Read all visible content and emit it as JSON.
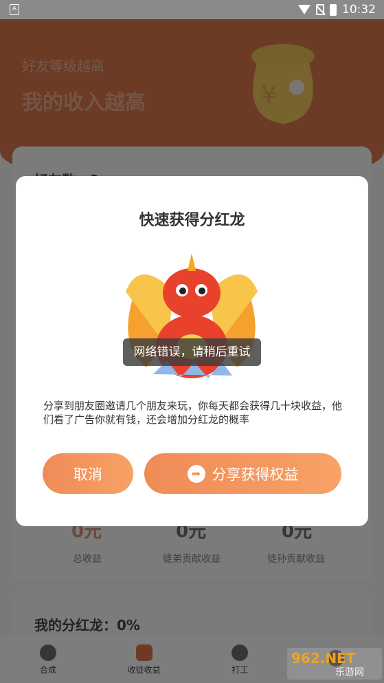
{
  "status_bar": {
    "left_badge": "A",
    "time": "10:32"
  },
  "header": {
    "subtitle": "好友等级越高",
    "title": "我的收入越高"
  },
  "background": {
    "friends_label": "好友数：0",
    "stats": [
      {
        "value": "0元",
        "label": "总收益"
      },
      {
        "value": "0元",
        "label": "徒弟贡献收益"
      },
      {
        "value": "0元",
        "label": "徒孙贡献收益"
      }
    ],
    "dragon_rate": "我的分红龙：0%"
  },
  "dialog": {
    "title": "快速获得分红龙",
    "toast": "网络错误，请稍后重试",
    "description": "分享到朋友圈邀请几个朋友来玩，你每天都会获得几十块收益，他们看了广告你就有钱，还会增加分红龙的概率",
    "cancel_label": "取消",
    "share_label": "分享获得权益"
  },
  "bottom_nav": {
    "items": [
      {
        "label": "合成",
        "icon": "merge-icon"
      },
      {
        "label": "收徒收益",
        "icon": "money-bag-icon"
      },
      {
        "label": "打工",
        "icon": "worker-icon"
      },
      {
        "label": "",
        "icon": "profile-icon"
      }
    ]
  },
  "watermark": {
    "text": "962.NET",
    "subtext": "乐游网"
  },
  "colors": {
    "accent": "#f08b57",
    "header": "#d9764a"
  }
}
